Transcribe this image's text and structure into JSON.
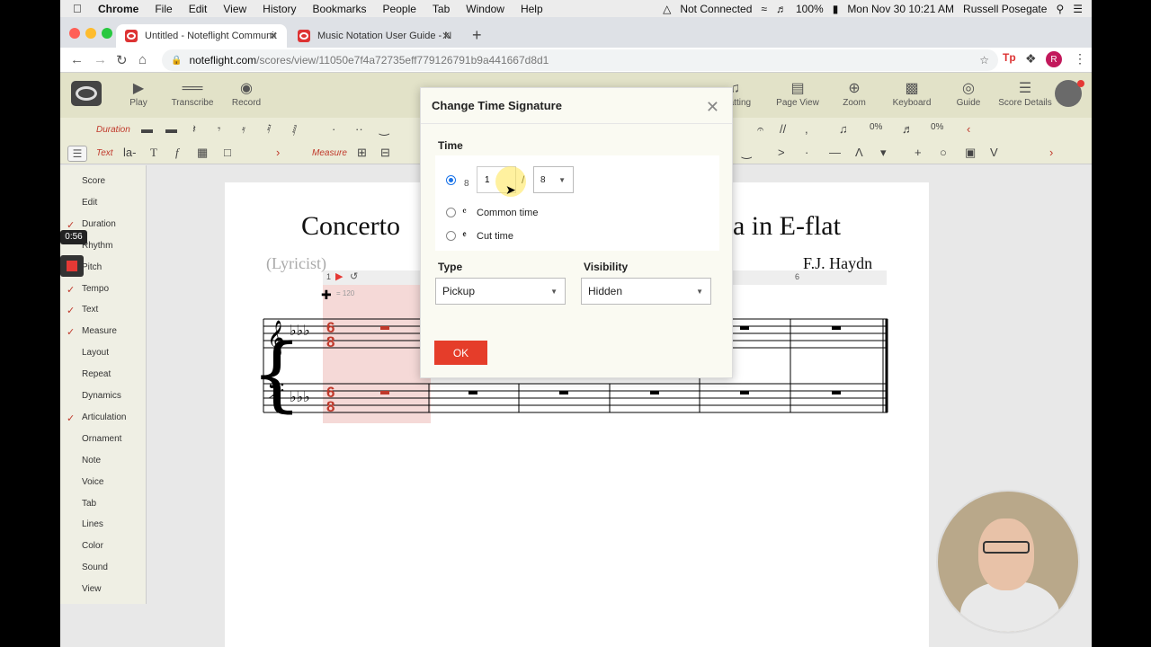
{
  "menubar": {
    "app": "Chrome",
    "items": [
      "File",
      "Edit",
      "View",
      "History",
      "Bookmarks",
      "People",
      "Tab",
      "Window",
      "Help"
    ],
    "status": {
      "network": "Not Connected",
      "battery": "100%",
      "datetime": "Mon Nov 30  10:21 AM",
      "user": "Russell Posegate"
    }
  },
  "tabs": [
    {
      "label": "Untitled - Noteflight Communit"
    },
    {
      "label": "Music Notation User Guide - N"
    }
  ],
  "address": {
    "host": "noteflight.com",
    "path": "/scores/view/11050e7f4a72735eff779126791b9a441667d8d1",
    "avatar_letter": "R"
  },
  "toolbar": {
    "left": [
      {
        "label": "Play",
        "icon": "play-icon"
      },
      {
        "label": "Transcribe",
        "icon": "transcribe-icon"
      },
      {
        "label": "Record",
        "icon": "record-icon"
      }
    ],
    "right": [
      {
        "label": "rmatting",
        "icon": "formatting-icon"
      },
      {
        "label": "Page View",
        "icon": "page-view-icon"
      },
      {
        "label": "Zoom",
        "icon": "zoom-icon"
      },
      {
        "label": "Keyboard",
        "icon": "keyboard-icon"
      },
      {
        "label": "Guide",
        "icon": "guide-icon"
      },
      {
        "label": "Score Details",
        "icon": "score-details-icon"
      }
    ]
  },
  "palette": {
    "duration_label": "Duration",
    "text_label": "Text",
    "measure_label": "Measure",
    "zoom1": "0%",
    "zoom2": "0%"
  },
  "sidemenu": {
    "items": [
      {
        "label": "Score",
        "checked": false
      },
      {
        "label": "Edit",
        "checked": false
      },
      {
        "label": "Duration",
        "checked": true
      },
      {
        "label": "Rhythm",
        "checked": false
      },
      {
        "label": "Pitch",
        "checked": true
      },
      {
        "label": "Tempo",
        "checked": true
      },
      {
        "label": "Text",
        "checked": true
      },
      {
        "label": "Measure",
        "checked": true
      },
      {
        "label": "Layout",
        "checked": false
      },
      {
        "label": "Repeat",
        "checked": false
      },
      {
        "label": "Dynamics",
        "checked": false
      },
      {
        "label": "Articulation",
        "checked": true
      },
      {
        "label": "Ornament",
        "checked": false
      },
      {
        "label": "Note",
        "checked": false
      },
      {
        "label": "Voice",
        "checked": false
      },
      {
        "label": "Tab",
        "checked": false
      },
      {
        "label": "Lines",
        "checked": false
      },
      {
        "label": "Color",
        "checked": false
      },
      {
        "label": "Sound",
        "checked": false
      },
      {
        "label": "View",
        "checked": false
      }
    ],
    "recording_time": "0:56"
  },
  "score": {
    "title_left": "Concerto",
    "title_right": "ra in E-flat",
    "lyricist": "(Lyricist)",
    "composer": "F.J. Haydn",
    "measure_number": "1",
    "measure_number_end": "6",
    "tempo": "= 120",
    "time_signature": "6/8"
  },
  "dialog": {
    "title": "Change Time Signature",
    "time_section": "Time",
    "numerator_prefix": "8",
    "numerator_value": "1",
    "denominator": "8",
    "common_time": "Common time",
    "cut_time": "Cut time",
    "type_section": "Type",
    "type_value": "Pickup",
    "visibility_section": "Visibility",
    "visibility_value": "Hidden",
    "ok_label": "OK"
  }
}
